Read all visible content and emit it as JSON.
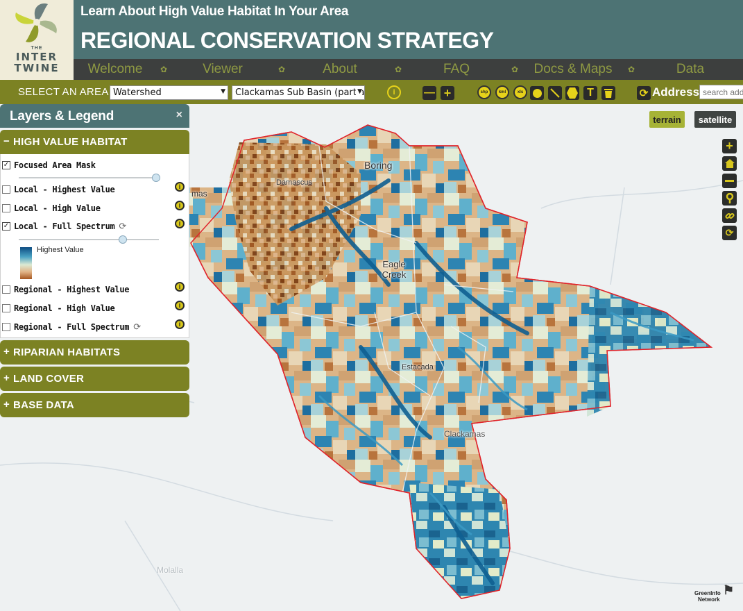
{
  "header": {
    "logo": {
      "top": "THE",
      "line1": "INTER",
      "line2": "TWINE"
    },
    "subtitle": "Learn About High Value Habitat In Your Area",
    "title": "REGIONAL CONSERVATION STRATEGY",
    "nav": [
      "Welcome",
      "Viewer",
      "About",
      "FAQ",
      "Docs & Maps",
      "Data"
    ]
  },
  "toolbar": {
    "select_label": "SELECT AN AREA:",
    "area_type": "Watershed",
    "area_value": "Clackamas Sub Basin (partia",
    "tools": [
      {
        "icon": "info-icon"
      },
      {
        "icon": "zoom-out-icon",
        "symbol": "—"
      },
      {
        "icon": "zoom-in-icon",
        "symbol": "+"
      },
      {
        "icon": "shp-icon",
        "label": "shp"
      },
      {
        "icon": "kml-icon",
        "label": "kml"
      },
      {
        "icon": "xls-icon",
        "label": "xls"
      },
      {
        "icon": "circle-draw-icon"
      },
      {
        "icon": "line-draw-icon"
      },
      {
        "icon": "polygon-draw-icon"
      },
      {
        "icon": "text-icon",
        "symbol": "T"
      },
      {
        "icon": "trash-icon"
      },
      {
        "icon": "refresh-icon"
      }
    ],
    "address_label": "Address:",
    "address_placeholder": "search address"
  },
  "panel": {
    "title": "Layers & Legend",
    "close": "×",
    "sections": [
      {
        "label": "HIGH VALUE HABITAT",
        "expanded": true,
        "layers": [
          {
            "name": "Focused Area Mask",
            "checked": true,
            "slider": 0.92
          },
          {
            "name": "Local - Highest Value",
            "checked": false
          },
          {
            "name": "Local - High Value",
            "checked": false
          },
          {
            "name": "Local - Full Spectrum",
            "checked": true,
            "slider": 0.74,
            "legend": "Highest Value"
          },
          {
            "name": "Regional - Highest Value",
            "checked": false
          },
          {
            "name": "Regional - High Value",
            "checked": false
          },
          {
            "name": "Regional - Full Spectrum",
            "checked": false
          }
        ]
      },
      {
        "label": "RIPARIAN HABITATS",
        "expanded": false
      },
      {
        "label": "LAND COVER",
        "expanded": false
      },
      {
        "label": "BASE DATA",
        "expanded": false
      }
    ]
  },
  "map": {
    "basemap_buttons": [
      "terrain",
      "satellite"
    ],
    "active_basemap": "terrain",
    "labels": [
      "Boring",
      "Damascus",
      "Eagle Creek",
      "Estacada",
      "Clackamas",
      "mas",
      "Molalla"
    ],
    "tools": [
      "zoom-in-icon",
      "home-icon",
      "zoom-out-icon",
      "locate-icon",
      "link-icon",
      "refresh-icon"
    ],
    "credit": {
      "line1": "GreenInfo",
      "line2": "Network"
    },
    "colors": {
      "deep": "#0d5f8f",
      "mid": "#4aa3c4",
      "pale": "#e3ecd5",
      "tan": "#deb585",
      "brown": "#a35a22",
      "boundary": "#e0242b"
    }
  }
}
